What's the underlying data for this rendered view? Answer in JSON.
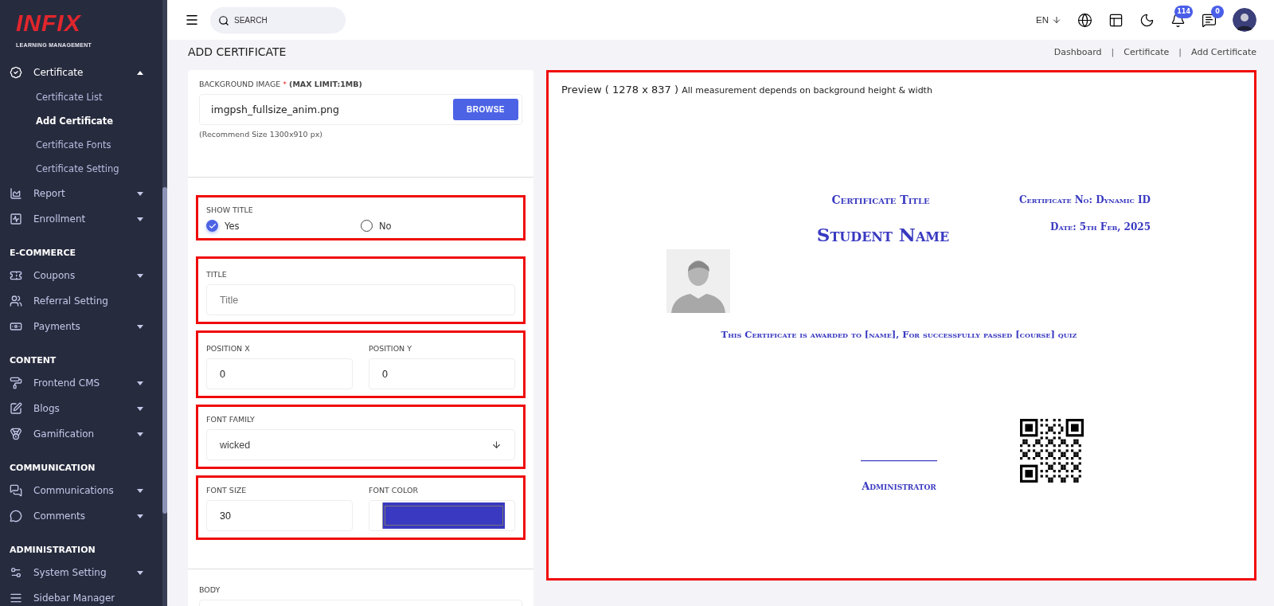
{
  "sidebar": {
    "logo": {
      "name": "INFIX",
      "tagline": "LEARNING MANAGEMENT"
    },
    "sections": [
      {
        "items": [
          {
            "label": "Certificate",
            "expanded": true,
            "children": [
              {
                "label": "Certificate List",
                "selected": false
              },
              {
                "label": "Add Certificate",
                "selected": true
              },
              {
                "label": "Certificate Fonts",
                "selected": false
              },
              {
                "label": "Certificate Setting",
                "selected": false
              }
            ]
          },
          {
            "label": "Report",
            "expanded": false
          },
          {
            "label": "Enrollment",
            "expanded": false
          }
        ]
      },
      {
        "heading": "E-COMMERCE",
        "items": [
          {
            "label": "Coupons",
            "expanded": false
          },
          {
            "label": "Referral Setting"
          },
          {
            "label": "Payments",
            "expanded": false
          }
        ]
      },
      {
        "heading": "CONTENT",
        "items": [
          {
            "label": "Frontend CMS",
            "expanded": false
          },
          {
            "label": "Blogs",
            "expanded": false
          },
          {
            "label": "Gamification",
            "expanded": false
          }
        ]
      },
      {
        "heading": "COMMUNICATION",
        "items": [
          {
            "label": "Communications",
            "expanded": false
          },
          {
            "label": "Comments",
            "expanded": false
          }
        ]
      },
      {
        "heading": "ADMINISTRATION",
        "items": [
          {
            "label": "System Setting",
            "expanded": false
          },
          {
            "label": "Sidebar Manager"
          }
        ]
      }
    ]
  },
  "topbar": {
    "search": {
      "placeholder": "SEARCH"
    },
    "language": "EN",
    "notifications": "114",
    "messages": "0"
  },
  "page": {
    "title": "ADD CERTIFICATE",
    "breadcrumbs": [
      "Dashboard",
      "Certificate",
      "Add Certificate"
    ],
    "breadcrumb_separators": [
      "|",
      "|"
    ]
  },
  "form": {
    "background_image": {
      "label": "BACKGROUND IMAGE",
      "required_mark": "*",
      "note": "(MAX LIMIT:1MB)",
      "value": "imgpsh_fullsize_anim.png",
      "button": "BROWSE",
      "hint": "(Recommend Size 1300x910 px)"
    },
    "show_title": {
      "label": "SHOW TITLE",
      "options": [
        {
          "label": "Yes",
          "selected": true
        },
        {
          "label": "No",
          "selected": false
        }
      ]
    },
    "title": {
      "label": "TITLE",
      "placeholder": "Title"
    },
    "position_x": {
      "label": "POSITION X",
      "value": "0"
    },
    "position_y": {
      "label": "POSITION Y",
      "value": "0"
    },
    "font_family": {
      "label": "FONT FAMILY",
      "value": "wicked"
    },
    "font_size": {
      "label": "FONT SIZE",
      "value": "30"
    },
    "font_color": {
      "label": "FONT COLOR",
      "color": "#3939c1"
    },
    "body": {
      "label": "BODY"
    }
  },
  "preview": {
    "heading": "Preview ( 1278 x 837 )",
    "note": "All measurement depends on background height & width",
    "certificate": {
      "title": "Certificate Title",
      "student_name": "Student Name",
      "certificate_no": "Certificate No: Dynamic ID",
      "date": "Date: 5th Feb, 2025",
      "body": "This Certificate is awarded to [name], For successfully passed [course] quiz",
      "signature_line": "________________",
      "signatory": "Administrator"
    }
  }
}
